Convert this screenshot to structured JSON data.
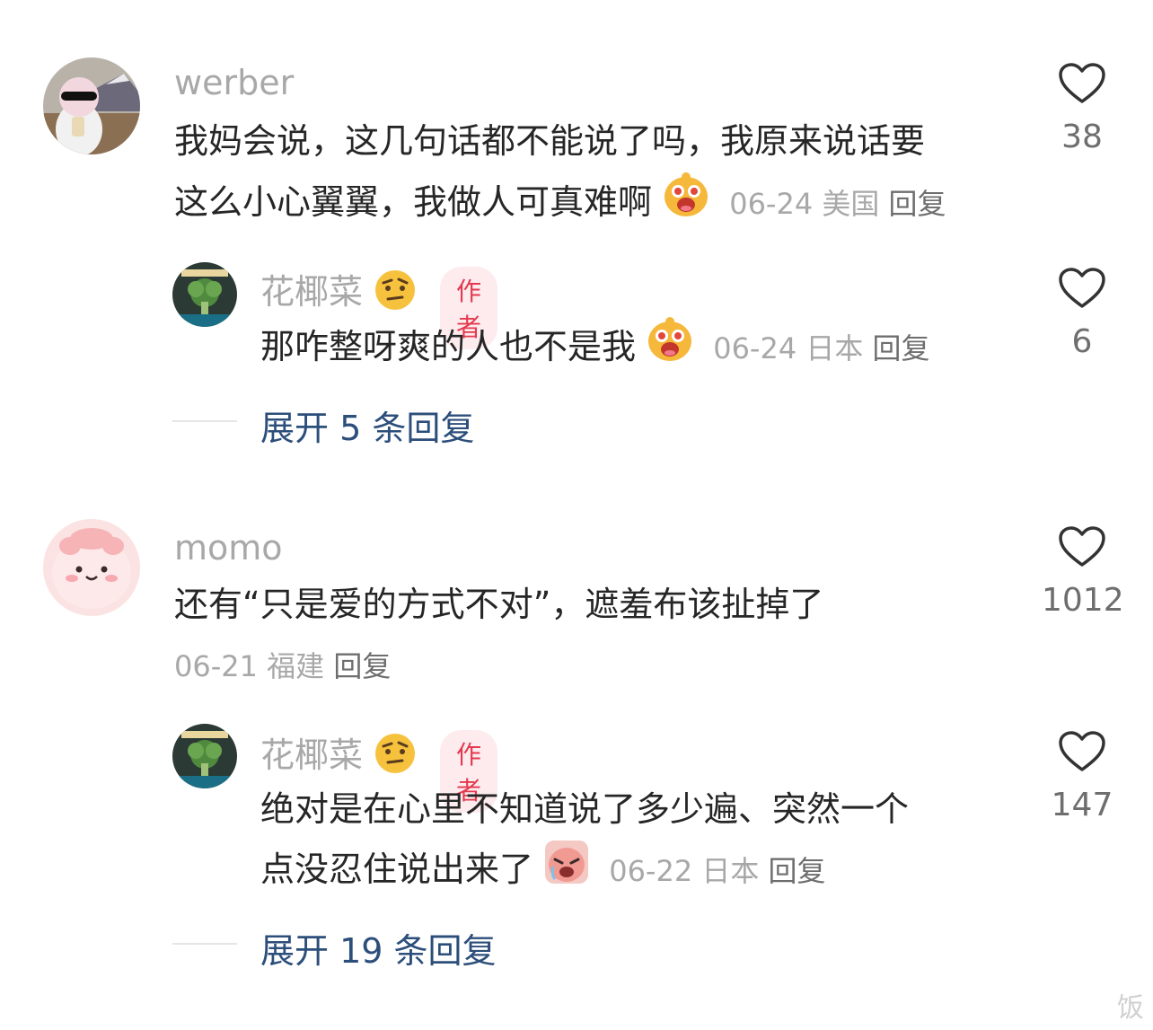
{
  "comments": [
    {
      "username": "werber",
      "text_line1": "我妈会说，这几句话都不能说了吗，我原来说话要",
      "text_line2": "这么小心翼翼，我做人可真难啊",
      "emoji": "laughing-face-emoji",
      "date": "06-24",
      "location": "美国",
      "reply_label": "回复",
      "likes": "38",
      "reply": {
        "username": "花椰菜",
        "user_emoji": "raised-eyebrow-emoji",
        "badge": "作者",
        "text_line1": "那咋整呀爽的人也不是我",
        "emoji": "laughing-face-emoji",
        "date": "06-24",
        "location": "日本",
        "reply_label": "回复",
        "likes": "6"
      },
      "expand": "展开 5 条回复"
    },
    {
      "username": "momo",
      "text_line1": "还有“只是爱的方式不对”，遮羞布该扯掉了",
      "date": "06-21",
      "location": "福建",
      "reply_label": "回复",
      "likes": "1012",
      "reply": {
        "username": "花椰菜",
        "user_emoji": "raised-eyebrow-emoji",
        "badge": "作者",
        "text_line1": "绝对是在心里不知道说了多少遍、突然一个",
        "text_line2": "点没忍住说出来了",
        "emoji": "crying-face-emoji",
        "date": "06-22",
        "location": "日本",
        "reply_label": "回复",
        "likes": "147"
      },
      "expand": "展开 19 条回复"
    }
  ],
  "icons": {
    "like": "heart-outline-icon"
  },
  "colors": {
    "username": "#a8a8a8",
    "expand": "#2c4e7a",
    "badge_bg": "#fdebee",
    "badge_text": "#e4394e"
  },
  "watermark": "饭"
}
